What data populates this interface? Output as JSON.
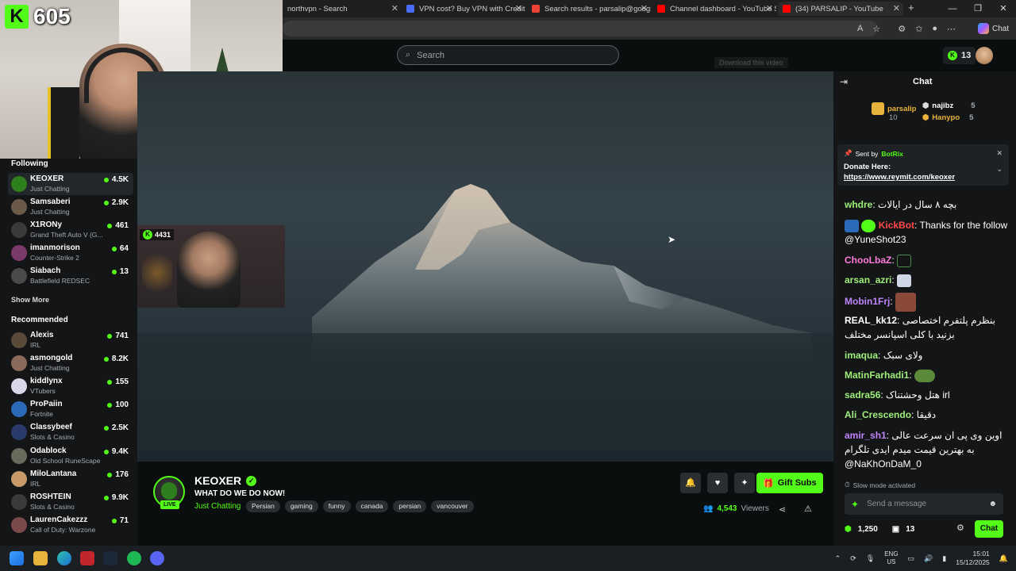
{
  "browser": {
    "tabs": [
      {
        "title": "northvpn - Search",
        "color": "#1f1f1f"
      },
      {
        "title": "VPN cost? Buy VPN with Credit C...",
        "color": "#4a6cf7"
      },
      {
        "title": "Search results - parsalip@google...",
        "color": "#ea4335"
      },
      {
        "title": "Channel dashboard - YouTube St...",
        "color": "#ff0000"
      },
      {
        "title": "(34) PARSALIP - YouTube",
        "color": "#ff0000"
      }
    ],
    "copilot_label": "Chat"
  },
  "webcam": {
    "kick_count": "605"
  },
  "header": {
    "search_placeholder": "Search",
    "points": "13"
  },
  "sidebar": {
    "following_heading": "Following",
    "following": [
      {
        "name": "KEOXER",
        "category": "Just Chatting",
        "viewers": "4.5K",
        "color": "#2e7d1e"
      },
      {
        "name": "Samsaberi",
        "category": "Just Chatting",
        "viewers": "2.9K",
        "color": "#6b5a4a"
      },
      {
        "name": "X1RONy",
        "category": "Grand Theft Auto V (G...",
        "viewers": "461",
        "color": "#3a3a3a"
      },
      {
        "name": "imanmorison",
        "category": "Counter-Strike 2",
        "viewers": "64",
        "color": "#7a3a6a"
      },
      {
        "name": "Siabach",
        "category": "Battlefield REDSEC",
        "viewers": "13",
        "color": "#4a4a4a"
      }
    ],
    "show_more": "Show More",
    "recommended_heading": "Recommended",
    "recommended": [
      {
        "name": "Alexis",
        "category": "IRL",
        "viewers": "741",
        "color": "#5a4a3a"
      },
      {
        "name": "asmongold",
        "category": "Just Chatting",
        "viewers": "8.2K",
        "color": "#8a6a5a"
      },
      {
        "name": "kiddlynx",
        "category": "VTubers",
        "viewers": "155",
        "color": "#d8d8e8"
      },
      {
        "name": "ProPaiin",
        "category": "Fortnite",
        "viewers": "100",
        "color": "#2a6ab8"
      },
      {
        "name": "Classybeef",
        "category": "Slots & Casino",
        "viewers": "2.5K",
        "color": "#2a3a6a"
      },
      {
        "name": "Odablock",
        "category": "Old School RuneScape",
        "viewers": "9.4K",
        "color": "#6a6a5a"
      },
      {
        "name": "MiloLantana",
        "category": "IRL",
        "viewers": "176",
        "color": "#c89a6a"
      },
      {
        "name": "ROSHTEIN",
        "category": "Slots & Casino",
        "viewers": "9.9K",
        "color": "#3a3a3a"
      },
      {
        "name": "LaurenCakezzz",
        "category": "Call of Duty: Warzone",
        "viewers": "71",
        "color": "#7a4a4a"
      }
    ]
  },
  "video": {
    "download_hint": "Download this video",
    "inset_viewers": "4431"
  },
  "stream": {
    "streamer": "KEOXER",
    "live": "LIVE",
    "title": "WHAT DO WE DO NOW!",
    "category": "Just Chatting",
    "tags": [
      "Persian",
      "gaming",
      "funny",
      "canada",
      "persian",
      "vancouver"
    ],
    "gift_subs": "Gift Subs",
    "viewers": "4,543",
    "viewers_label": "Viewers"
  },
  "chat": {
    "title": "Chat",
    "leaders": [
      {
        "name": "parsalip",
        "sub": "10",
        "color": "#e8b33a"
      },
      {
        "name": "najibz",
        "sub": "5",
        "color": "#ffffff"
      },
      {
        "name": "Hanypo",
        "sub": "5",
        "color": "#e8b33a"
      }
    ],
    "pinned": {
      "sent_by": "Sent by",
      "sender": "BotRix",
      "donate": "Donate Here:",
      "link": "https://www.reymit.com/keoxer"
    },
    "messages": [
      {
        "user": "whdre",
        "color": "#9ef07a",
        "text": "بچه ۸ سال در ایالات"
      },
      {
        "user": "KickBot",
        "color": "#ff4a4a",
        "text": "Thanks for the follow @YuneShot23"
      },
      {
        "user": "ChooLbaZ",
        "color": "#ff7ad9",
        "text": ""
      },
      {
        "user": "arsan_azri",
        "color": "#9ef07a",
        "text": ""
      },
      {
        "user": "Mobin1Frj",
        "color": "#c084fc",
        "text": ""
      },
      {
        "user": "REAL_kk12",
        "color": "#ffffff",
        "text": "بنظرم پلتفرم اختصاصی بزنید با کلی اسپانسر مختلف"
      },
      {
        "user": "imaqua",
        "color": "#9ef07a",
        "text": "ولای سبک"
      },
      {
        "user": "MatinFarhadi1",
        "color": "#9ef07a",
        "text": ""
      },
      {
        "user": "sadra56",
        "color": "#9ef07a",
        "text": "هتل وحشتناک irl"
      },
      {
        "user": "Ali_Crescendo",
        "color": "#9ef07a",
        "text": "دقیقا"
      },
      {
        "user": "amir_sh1",
        "color": "#c084fc",
        "text": "اوین وی پی ان سرعت عالی به بهترین قیمت میدم ایدی تلگرام @NaKhOnDaM_0"
      }
    ],
    "slow_mode": "Slow mode activated",
    "send_placeholder": "Send a message",
    "footer_points": "1,250",
    "footer_count": "13",
    "chat_button": "Chat"
  },
  "taskbar": {
    "lang_top": "ENG",
    "lang_bottom": "US",
    "time": "15:01",
    "date": "15/12/2025"
  }
}
